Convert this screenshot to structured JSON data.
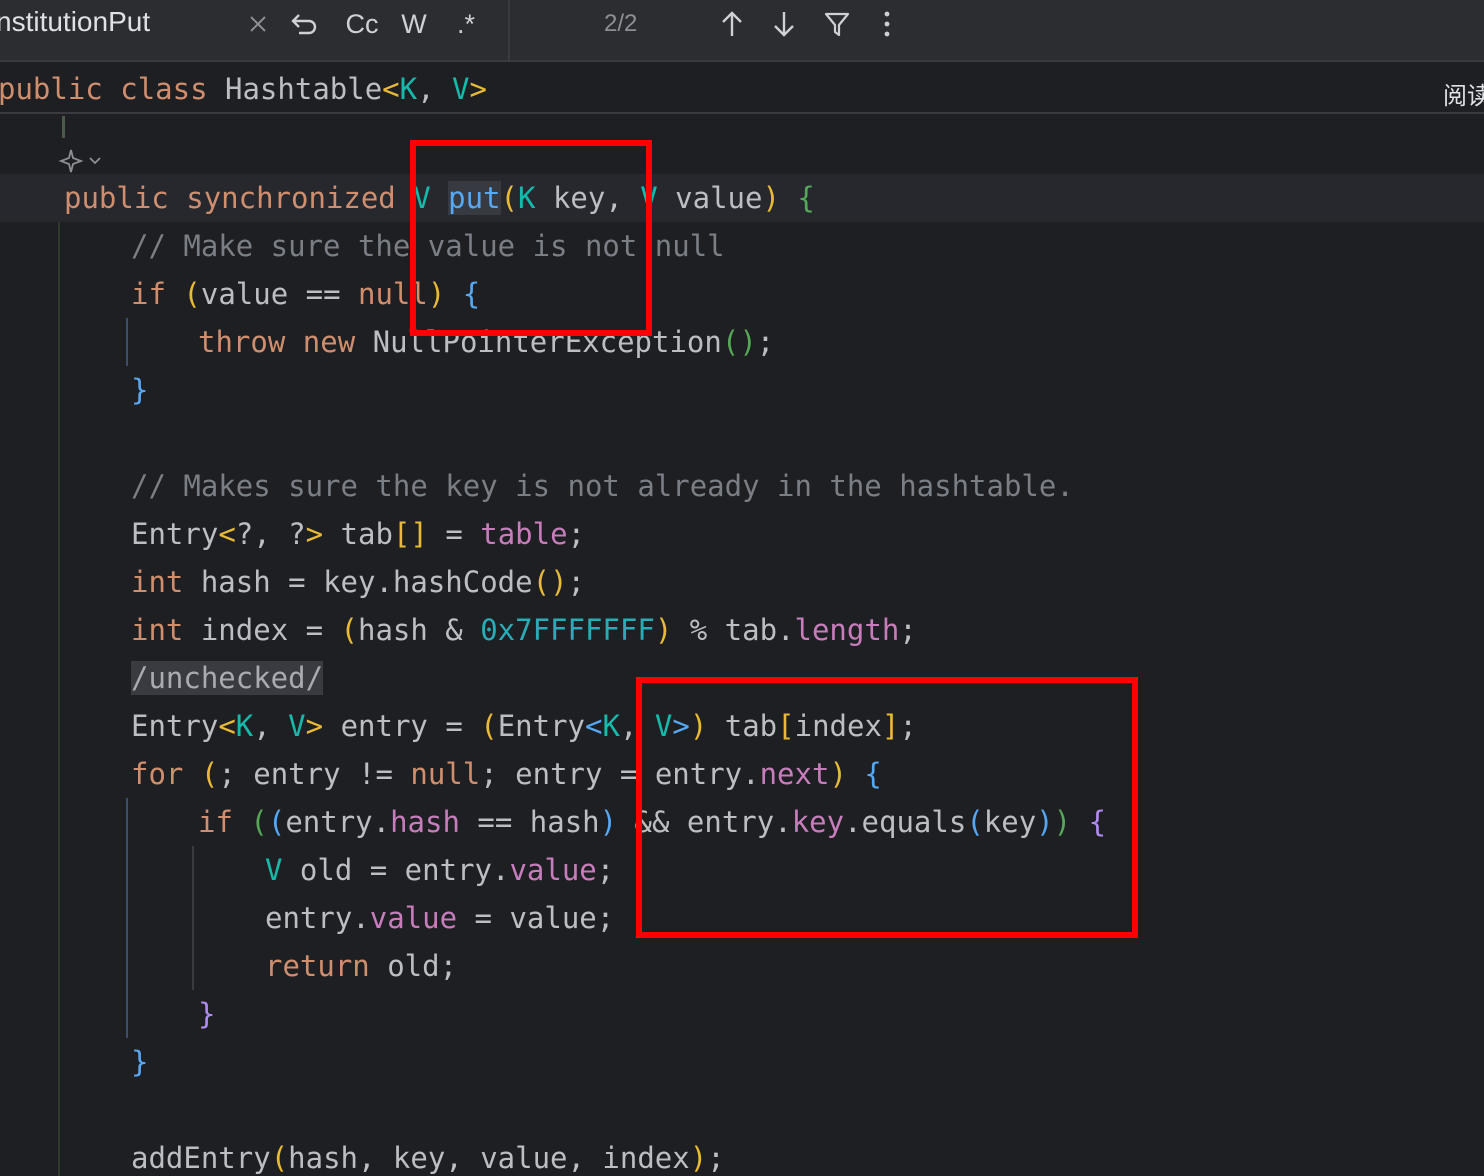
{
  "find_bar": {
    "query": "nstitutionPut",
    "match_case_label": "Cc",
    "words_label": "W",
    "regex_label": ".*",
    "match_count": "2/2",
    "icons": [
      "close-icon",
      "replace-history-icon",
      "arrow-up-icon",
      "arrow-down-icon",
      "filter-icon",
      "more-vertical-icon"
    ]
  },
  "sticky_header": {
    "kw_public": "public",
    "kw_class": "class",
    "class_name": "Hashtable",
    "lt": "<",
    "type_k": "K",
    "comma": ", ",
    "type_v": "V",
    "gt": ">",
    "reader_mode_label": "阅读"
  },
  "code": {
    "l1": {
      "public": "public",
      "synchronized": "synchronized",
      "ret": "V",
      "name": "put",
      "po": "(",
      "k": "K",
      "key": " key, ",
      "v": "V",
      "value": " value",
      "pc": ")",
      "brace": "{"
    },
    "l2": {
      "comment": "// Make sure the value is not null"
    },
    "l3": {
      "if": "if",
      "po": "(",
      "cond": "value == ",
      "null": "null",
      "pc": ")",
      "brace": "{"
    },
    "l4": {
      "throw": "throw",
      "new": "new",
      "cls": "NullPointerException",
      "po": "(",
      "pc": ")",
      "semi": ";"
    },
    "l5": {
      "brace": "}"
    },
    "l6": {
      "comment": "// Makes sure the key is not already in the hashtable."
    },
    "l7": {
      "t1": "Entry",
      "lt": "<",
      "wild": "?, ?",
      "gt": ">",
      "t2": " tab",
      "bo": "[",
      "bc": "]",
      "t3": " = ",
      "field": "table",
      "semi": ";"
    },
    "l8": {
      "int": "int",
      "t1": " hash = key.hashCode",
      "po": "(",
      "pc": ")",
      "semi": ";"
    },
    "l9": {
      "int": "int",
      "t1": " index = ",
      "po": "(",
      "t2": "hash & ",
      "hex": "0x7FFFFFFF",
      "pc": ")",
      "t3": " % tab.",
      "field": "length",
      "semi": ";"
    },
    "l10": {
      "fold": "/unchecked/"
    },
    "l11": {
      "t1": "Entry",
      "lt": "<",
      "k": "K",
      "comma": ", ",
      "v": "V",
      "gt": ">",
      "t2": " entry = ",
      "po": "(",
      "t3": "Entry",
      "lt2": "<",
      "k2": "K",
      "comma2": ", ",
      "v2": "V",
      "gt2": ">",
      "pc": ")",
      "t4": " tab",
      "bo": "[",
      "t5": "index",
      "bc": "]",
      "semi": ";"
    },
    "l12": {
      "for": "for",
      "po": "(",
      "t1": "; entry != ",
      "null": "null",
      "t2": "; entry = entry.",
      "field": "next",
      "pc": ")",
      "brace": "{"
    },
    "l13": {
      "if": "if",
      "po": "(",
      "po2": "(",
      "t1": "entry.",
      "f1": "hash",
      "t2": " == hash",
      "pc2": ")",
      "t3": " && entry.",
      "f2": "key",
      "t4": ".equals",
      "po3": "(",
      "t5": "key",
      "pc3": ")",
      "pc": ")",
      "brace": "{"
    },
    "l14": {
      "v": "V",
      "t1": " old = entry.",
      "field": "value",
      "semi": ";"
    },
    "l15": {
      "t1": "entry.",
      "field": "value",
      "t2": " = value;"
    },
    "l16": {
      "return": "return",
      "t1": " old;"
    },
    "l17": {
      "brace": "}"
    },
    "l18": {
      "brace": "}"
    },
    "l19": {
      "t1": "addEntry",
      "po": "(",
      "t2": "hash, key, value, index",
      "pc": ")",
      "semi": ";"
    }
  },
  "colors": {
    "keyword": "#cf8e6d",
    "type_param": "#16baac",
    "method": "#56a8f5",
    "field": "#c77dbb",
    "comment": "#7a7e85",
    "annotation_box": "#ff0000"
  }
}
